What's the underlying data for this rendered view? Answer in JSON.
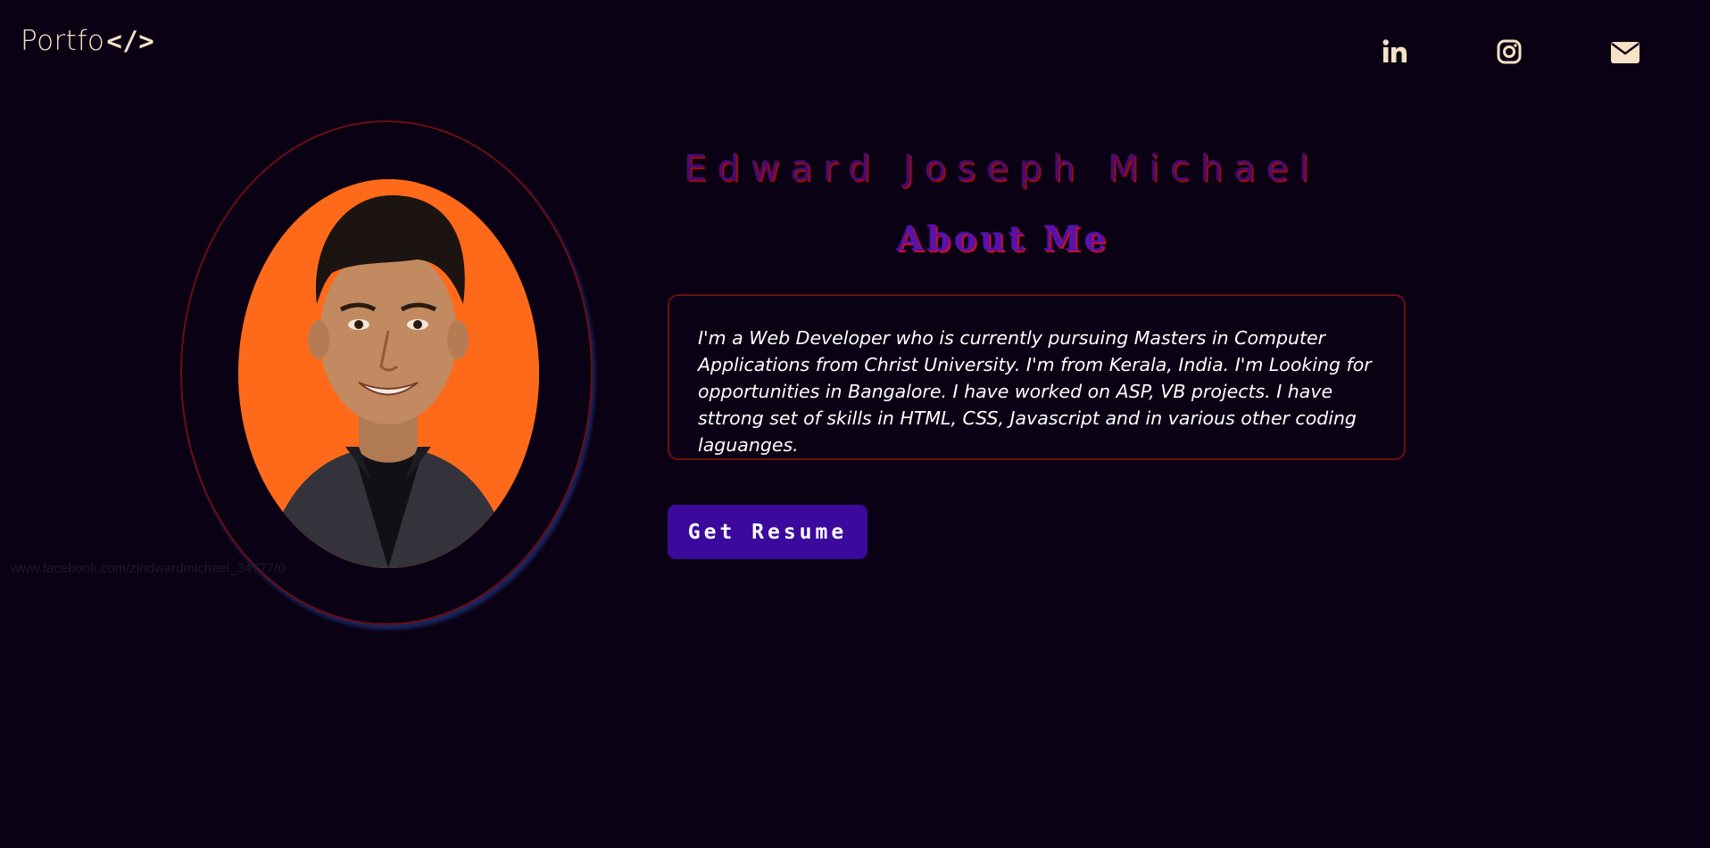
{
  "header": {
    "logo_text": "Portfo",
    "logo_code": "</>",
    "social": [
      {
        "name": "linkedin",
        "icon": "linkedin-icon"
      },
      {
        "name": "instagram",
        "icon": "instagram-icon"
      },
      {
        "name": "email",
        "icon": "envelope-icon"
      }
    ]
  },
  "profile": {
    "image_alt": "www.facebook.com/zindwardmichael_34777/0",
    "name": "Edward Joseph Michael",
    "section_title": "About Me",
    "bio": "I'm a Web Developer who is currently pursuing Masters in Computer Applications from Christ University. I'm from Kerala, India. I'm Looking for opportunities in Bangalore. I have worked on ASP, VB projects. I have sttrong set of skills in HTML, CSS, Javascript and in various other coding laguanges.",
    "resume_button": "Get Resume"
  },
  "colors": {
    "background": "#0b0114",
    "accent_text": "#f7e1c6",
    "border_red": "#6a0f15",
    "button_purple": "#3b0a9c",
    "name_purple": "#4a0b6e",
    "portrait_bg": "#ff6a1a"
  }
}
